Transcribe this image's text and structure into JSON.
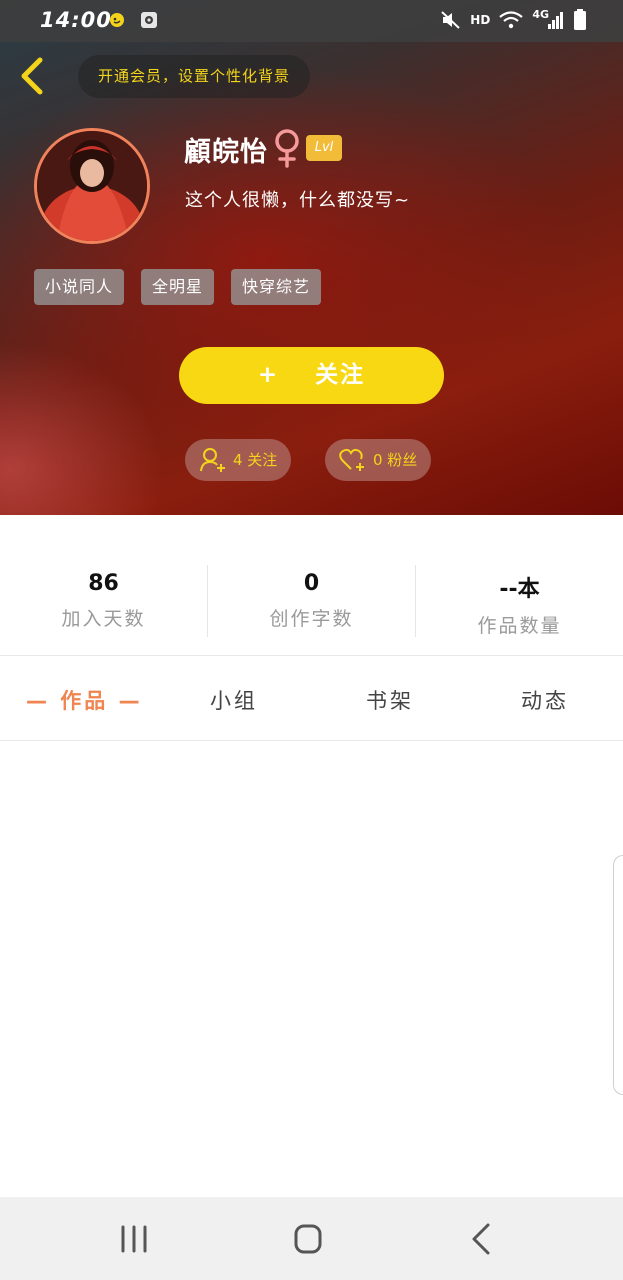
{
  "status_bar": {
    "time": "14:00",
    "network_label": "HD",
    "network_type": "4G",
    "icons": [
      "notification-app-icon",
      "screen-record-icon",
      "mute-icon",
      "wifi-icon",
      "signal-icon",
      "battery-icon"
    ]
  },
  "top_bar": {
    "back_icon": "chevron-left-icon",
    "vip_banner_text": "开通会员，设置个性化背景"
  },
  "profile": {
    "name": "顧皖怡",
    "gender_symbol": "♀",
    "level": "Lvl",
    "bio": "这个人很懒，什么都没写~",
    "tags": [
      "小说同人",
      "全明星",
      "快穿综艺"
    ]
  },
  "actions": {
    "follow_plus": "+",
    "follow_label": "关注",
    "following_text": "4 关注",
    "fans_text": "0 粉丝"
  },
  "stats": [
    {
      "value": "86",
      "label": "加入天数"
    },
    {
      "value": "0",
      "label": "创作字数"
    },
    {
      "value": "--本",
      "label": "作品数量"
    }
  ],
  "tabs": [
    {
      "label": "— 作品 —",
      "active": true
    },
    {
      "label": "小组",
      "active": false
    },
    {
      "label": "书架",
      "active": false
    },
    {
      "label": "动态",
      "active": false
    }
  ],
  "colors": {
    "accent_yellow": "#f8d812",
    "accent_orange": "#ef8550",
    "level_badge": "#f2bc39",
    "hero_red": "#8a1e0e"
  }
}
